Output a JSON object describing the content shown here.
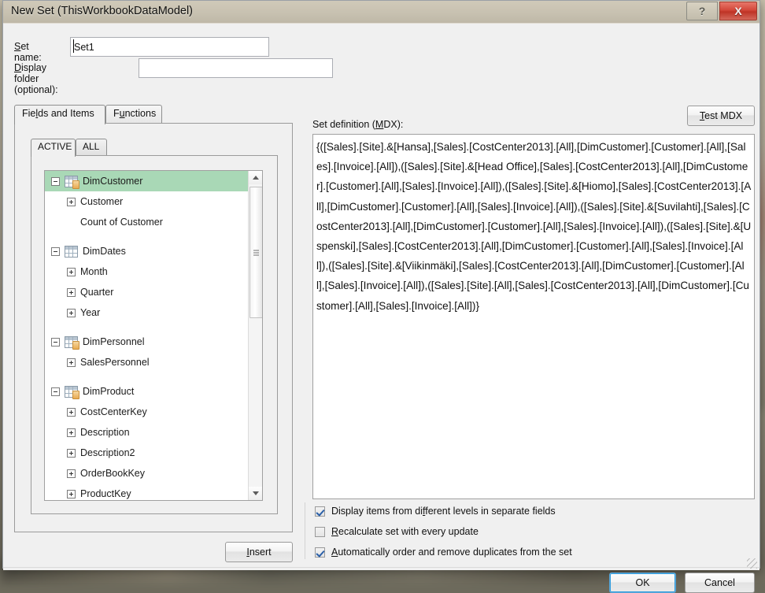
{
  "window": {
    "title": "New Set (ThisWorkbookDataModel)",
    "help_button": "?",
    "close_button": "X"
  },
  "form": {
    "set_name_label": "Set name:",
    "set_name_value": "Set1",
    "display_folder_label": "Display folder (optional):",
    "display_folder_value": ""
  },
  "main_tabs": [
    {
      "label": "Fields and Items",
      "selected": true
    },
    {
      "label": "Functions",
      "selected": false
    }
  ],
  "sub_tabs": [
    {
      "label": "ACTIVE",
      "selected": true
    },
    {
      "label": "ALL",
      "selected": false
    }
  ],
  "tree": {
    "items": [
      {
        "label": "DimCustomer",
        "level": 0,
        "expander": "minus",
        "icon": "table-tagged-icon",
        "selected": true,
        "gap": false
      },
      {
        "label": "Customer",
        "level": 1,
        "expander": "plus",
        "icon": "none",
        "selected": false,
        "gap": false
      },
      {
        "label": "Count of Customer",
        "level": 1,
        "expander": "none",
        "icon": "none",
        "selected": false,
        "gap": false
      },
      {
        "label": "DimDates",
        "level": 0,
        "expander": "minus",
        "icon": "table-icon",
        "selected": false,
        "gap": true
      },
      {
        "label": "Month",
        "level": 1,
        "expander": "plus",
        "icon": "none",
        "selected": false,
        "gap": false
      },
      {
        "label": "Quarter",
        "level": 1,
        "expander": "plus",
        "icon": "none",
        "selected": false,
        "gap": false
      },
      {
        "label": "Year",
        "level": 1,
        "expander": "plus",
        "icon": "none",
        "selected": false,
        "gap": false
      },
      {
        "label": "DimPersonnel",
        "level": 0,
        "expander": "minus",
        "icon": "table-tagged-icon",
        "selected": false,
        "gap": true
      },
      {
        "label": "SalesPersonnel",
        "level": 1,
        "expander": "plus",
        "icon": "none",
        "selected": false,
        "gap": false
      },
      {
        "label": "DimProduct",
        "level": 0,
        "expander": "minus",
        "icon": "table-tagged-icon",
        "selected": false,
        "gap": true
      },
      {
        "label": "CostCenterKey",
        "level": 1,
        "expander": "plus",
        "icon": "none",
        "selected": false,
        "gap": false
      },
      {
        "label": "Description",
        "level": 1,
        "expander": "plus",
        "icon": "none",
        "selected": false,
        "gap": false
      },
      {
        "label": "Description2",
        "level": 1,
        "expander": "plus",
        "icon": "none",
        "selected": false,
        "gap": false
      },
      {
        "label": "OrderBookKey",
        "level": 1,
        "expander": "plus",
        "icon": "none",
        "selected": false,
        "gap": false
      },
      {
        "label": "ProductKey",
        "level": 1,
        "expander": "plus",
        "icon": "none",
        "selected": false,
        "gap": false
      }
    ],
    "scrollbar": {
      "up_arrow": "▲",
      "down_arrow": "▼"
    }
  },
  "insert_button": "Insert",
  "mdx": {
    "label": "Set definition (MDX):",
    "test_button": "Test MDX",
    "value": "{([Sales].[Site].&[Hansa],[Sales].[CostCenter2013].[All],[DimCustomer].[Customer].[All],[Sales].[Invoice].[All]),([Sales].[Site].&[Head Office],[Sales].[CostCenter2013].[All],[DimCustomer].[Customer].[All],[Sales].[Invoice].[All]),([Sales].[Site].&[Hiomo],[Sales].[CostCenter2013].[All],[DimCustomer].[Customer].[All],[Sales].[Invoice].[All]),([Sales].[Site].&[Suvilahti],[Sales].[CostCenter2013].[All],[DimCustomer].[Customer].[All],[Sales].[Invoice].[All]),([Sales].[Site].&[Uspenski],[Sales].[CostCenter2013].[All],[DimCustomer].[Customer].[All],[Sales].[Invoice].[All]),([Sales].[Site].&[Viikinmäki],[Sales].[CostCenter2013].[All],[DimCustomer].[Customer].[All],[Sales].[Invoice].[All]),([Sales].[Site].[All],[Sales].[CostCenter2013].[All],[DimCustomer].[Customer].[All],[Sales].[Invoice].[All])}"
  },
  "options": [
    {
      "label": "Display items from different levels in separate fields",
      "checked": true
    },
    {
      "label": "Recalculate set with every update",
      "checked": false
    },
    {
      "label": "Automatically order and remove duplicates from the set",
      "checked": true
    }
  ],
  "footer": {
    "ok_label": "OK",
    "cancel_label": "Cancel"
  },
  "colors": {
    "selection_green": "#a9d8b6",
    "focus_blue": "#2e9bdc",
    "close_red": "#bf3426"
  }
}
